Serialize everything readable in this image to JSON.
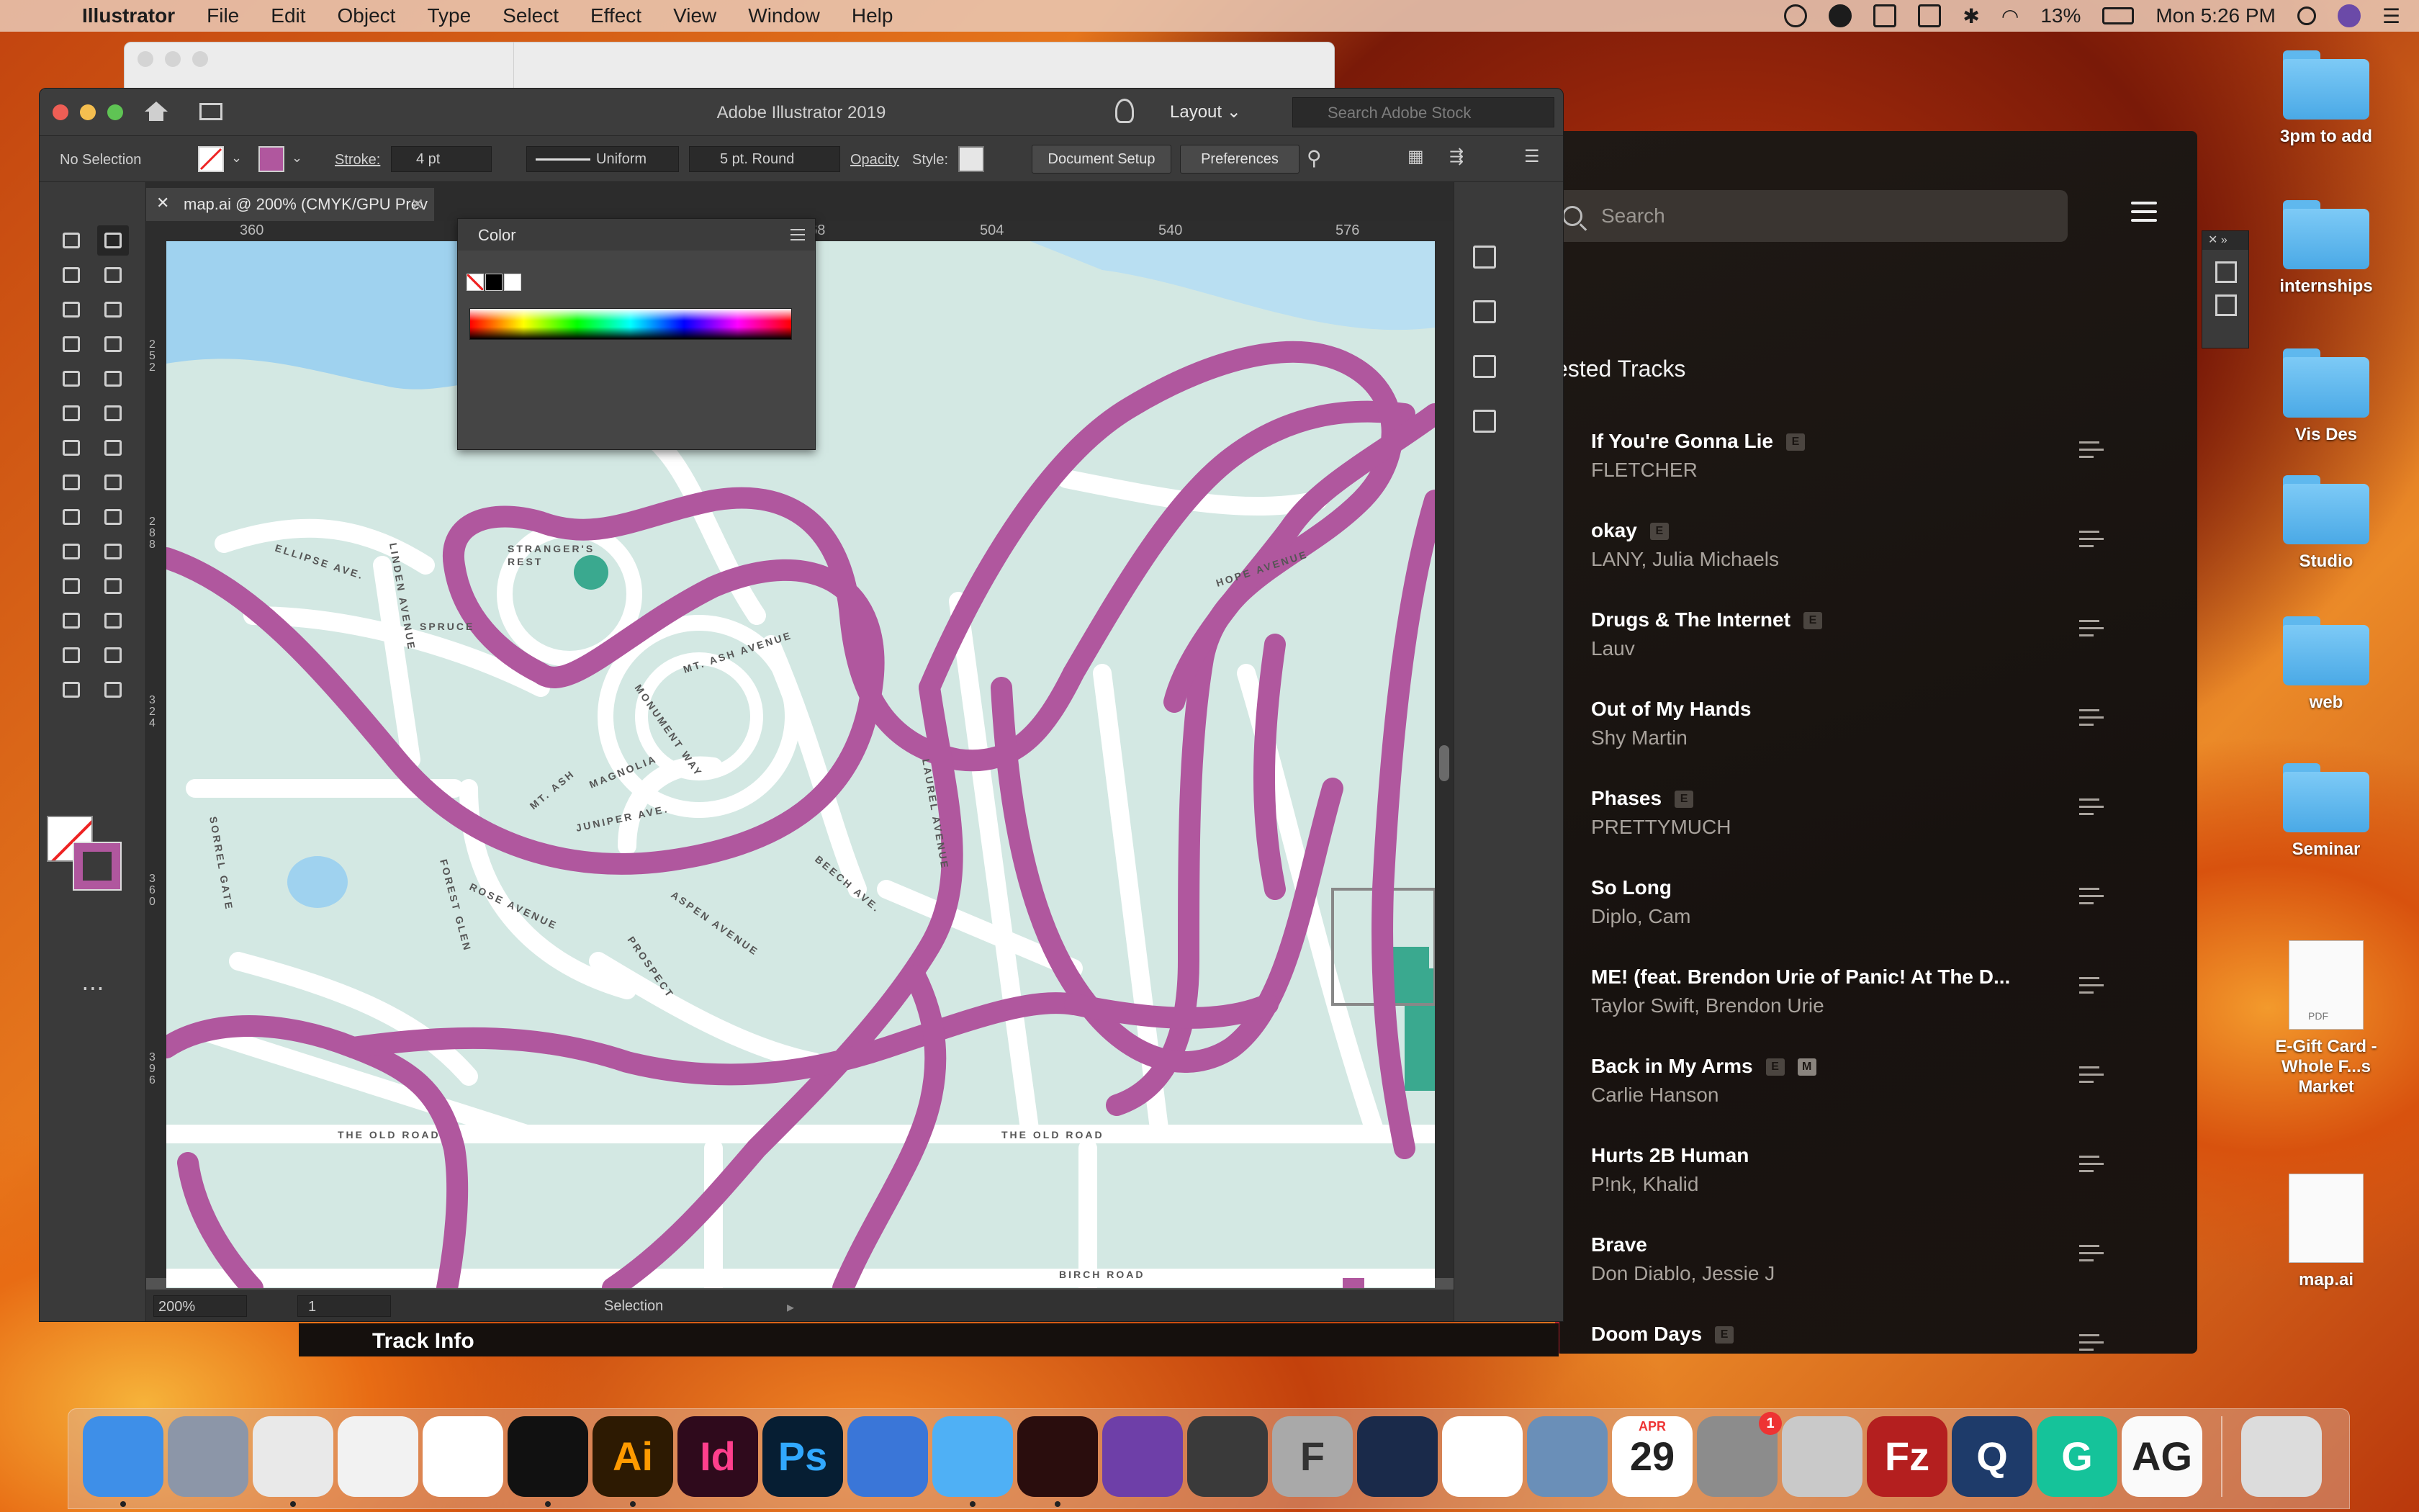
{
  "menubar": {
    "app_name": "Illustrator",
    "items": [
      "File",
      "Edit",
      "Object",
      "Type",
      "Select",
      "Effect",
      "View",
      "Window",
      "Help"
    ],
    "battery": "13%",
    "clock": "Mon 5:26 PM",
    "status_icons": [
      "creative-cloud-icon",
      "record-icon",
      "screen-icon",
      "airplay-icon",
      "bluetooth-icon",
      "wifi-icon",
      "battery-icon",
      "spotlight-icon",
      "siri-icon",
      "notification-icon"
    ]
  },
  "illustrator": {
    "window_title": "Adobe Illustrator 2019",
    "layout_label": "Layout",
    "stock_search_placeholder": "Search Adobe Stock",
    "control": {
      "selection": "No Selection",
      "stroke_label": "Stroke:",
      "stroke_value": "4 pt",
      "profile": "Uniform",
      "brush": "5 pt. Round",
      "opacity_label": "Opacity",
      "style_label": "Style:",
      "document_setup": "Document Setup",
      "preferences": "Preferences"
    },
    "tab_label": "map.ai @ 200% (CMYK/GPU Prev",
    "ruler_top": [
      "360",
      "468",
      "504",
      "540",
      "576"
    ],
    "ruler_left": [
      "252",
      "288",
      "324",
      "360",
      "396"
    ],
    "color_panel_title": "Color",
    "status": {
      "zoom": "200%",
      "page": "1",
      "tool": "Selection"
    },
    "colors": {
      "stroke_accent": "#b0579e",
      "water": "#9fd2ef",
      "land": "#d3e8e3",
      "teal_marker": "#3aa98f"
    },
    "map_labels": {
      "strangers_rest_1": "STRANGER'S",
      "strangers_rest_2": "REST",
      "ellipse_ave": "ELLIPSE AVE.",
      "linden_avenue": "LINDEN AVENUE",
      "spruce": "SPRUCE",
      "mt_ash_avenue": "MT. ASH AVENUE",
      "monument_way": "MONUMENT WAY",
      "hope_avenue": "HOPE AVENUE",
      "magnolia": "MAGNOLIA",
      "juniper_ave": "JUNIPER AVE.",
      "mt_ash": "MT. ASH",
      "laurel_avenue": "LAUREL AVENUE",
      "beech_ave": "BEECH AVE.",
      "rose_avenue": "ROSE AVENUE",
      "aspen_avenue": "ASPEN AVENUE",
      "forest_glen": "FOREST GLEN",
      "prospect": "PROSPECT",
      "old_road_1": "THE OLD ROAD",
      "old_road_2": "THE OLD ROAD",
      "birch_road": "BIRCH ROAD",
      "sorrel_gate": "SORREL GATE"
    }
  },
  "music": {
    "search_placeholder": "Search",
    "section_title": "ested Tracks",
    "track_info": "Track Info",
    "tracks": [
      {
        "title": "If You're Gonna Lie",
        "artist": "FLETCHER",
        "explicit": "E",
        "color": "#c7302c"
      },
      {
        "title": "okay",
        "artist": "LANY, Julia Michaels",
        "explicit": "E",
        "color": "#6d7e9c"
      },
      {
        "title": "Drugs & The Internet",
        "artist": "Lauv",
        "explicit": "E",
        "color": "#d94d3a"
      },
      {
        "title": "Out of My Hands",
        "artist": "Shy Martin",
        "explicit": "",
        "color": "#d8a7b8"
      },
      {
        "title": "Phases",
        "artist": "PRETTYMUCH",
        "explicit": "E",
        "color": "#3e68a8"
      },
      {
        "title": "So Long",
        "artist": "Diplo, Cam",
        "explicit": "",
        "color": "#e8cf8d"
      },
      {
        "title": "ME! (feat. Brendon Urie of Panic! At The D...",
        "artist": "Taylor Swift, Brendon Urie",
        "explicit": "",
        "color": "#9bd6e2"
      },
      {
        "title": "Back in My Arms",
        "artist": "Carlie Hanson",
        "explicit": "E",
        "master": "M",
        "color": "#a06a4a"
      },
      {
        "title": "Hurts 2B Human",
        "artist": "P!nk, Khalid",
        "explicit": "",
        "color": "#7c7c7c"
      },
      {
        "title": "Brave",
        "artist": "Don Diablo, Jessie J",
        "explicit": "",
        "color": "#c4a15a"
      },
      {
        "title": "Doom Days",
        "artist": "",
        "explicit": "E",
        "color": "#b11e2c"
      }
    ]
  },
  "desktop": {
    "items": [
      {
        "label": "3pm to add",
        "kind": "folder"
      },
      {
        "label": "internships",
        "kind": "folder"
      },
      {
        "label": "Vis Des",
        "kind": "folder"
      },
      {
        "label": "Studio",
        "kind": "folder"
      },
      {
        "label": "web",
        "kind": "folder"
      },
      {
        "label": "Seminar",
        "kind": "folder"
      },
      {
        "label": "E-Gift Card -\nWhole F...s Market",
        "kind": "pdf",
        "tag": "PDF"
      },
      {
        "label": "map.ai",
        "kind": "doc"
      }
    ]
  },
  "dock": {
    "apps": [
      {
        "name": "finder",
        "glyph": "",
        "bg": "#3e8fe8",
        "running": true
      },
      {
        "name": "launchpad",
        "glyph": "",
        "bg": "#8c96a8",
        "running": false
      },
      {
        "name": "chrome",
        "glyph": "",
        "bg": "#e9e9e9",
        "running": true
      },
      {
        "name": "textedit",
        "glyph": "",
        "bg": "#f2f2f2",
        "running": false
      },
      {
        "name": "slack",
        "glyph": "",
        "bg": "#ffffff",
        "running": false
      },
      {
        "name": "tidal",
        "glyph": "",
        "bg": "#111111",
        "running": true
      },
      {
        "name": "illustrator",
        "glyph": "Ai",
        "bg": "#2d1a02",
        "fg": "#ff9a00",
        "running": true
      },
      {
        "name": "indesign",
        "glyph": "Id",
        "bg": "#2f0a1c",
        "fg": "#ff3f8c",
        "running": false
      },
      {
        "name": "photoshop",
        "glyph": "Ps",
        "bg": "#061e33",
        "fg": "#31a8ff",
        "running": false
      },
      {
        "name": "keynote",
        "glyph": "",
        "bg": "#3a76d8",
        "running": false
      },
      {
        "name": "messages",
        "glyph": "",
        "bg": "#4fb0f5",
        "running": true
      },
      {
        "name": "acrobat",
        "glyph": "",
        "bg": "#2a0d0d",
        "fg": "#ff3a2f",
        "running": true
      },
      {
        "name": "github",
        "glyph": "",
        "bg": "#6e3fa8",
        "running": false
      },
      {
        "name": "sublime",
        "glyph": "",
        "bg": "#3a3a3a",
        "fg": "#ff9a24",
        "running": false
      },
      {
        "name": "fontbook",
        "glyph": "F",
        "bg": "#a9a9a9",
        "fg": "#333333",
        "running": false
      },
      {
        "name": "cinema4d",
        "glyph": "",
        "bg": "#1a2a4a",
        "running": false
      },
      {
        "name": "photos",
        "glyph": "",
        "bg": "#ffffff",
        "running": false
      },
      {
        "name": "preview",
        "glyph": "",
        "bg": "#6a8fb8",
        "running": false
      },
      {
        "name": "calendar",
        "glyph": "29",
        "bg": "#ffffff",
        "fg": "#222222",
        "running": false
      },
      {
        "name": "system-preferences",
        "glyph": "",
        "bg": "#8c8c8c",
        "badge": "1",
        "running": false
      },
      {
        "name": "calculator",
        "glyph": "",
        "bg": "#c9c9c9",
        "running": false
      },
      {
        "name": "filezilla",
        "glyph": "Fz",
        "bg": "#b41f1f",
        "fg": "#ffffff",
        "running": false
      },
      {
        "name": "quicktime",
        "glyph": "Q",
        "bg": "#1e3b6a",
        "fg": "#ffffff",
        "running": false
      },
      {
        "name": "grammarly",
        "glyph": "G",
        "bg": "#15c39a",
        "fg": "#ffffff",
        "running": false
      },
      {
        "name": "dictionary",
        "glyph": "AG",
        "bg": "#fafafa",
        "fg": "#222222",
        "running": false
      },
      {
        "name": "trash",
        "glyph": "",
        "bg": "#dcdcdc",
        "running": false
      }
    ],
    "calendar_month": "APR"
  }
}
